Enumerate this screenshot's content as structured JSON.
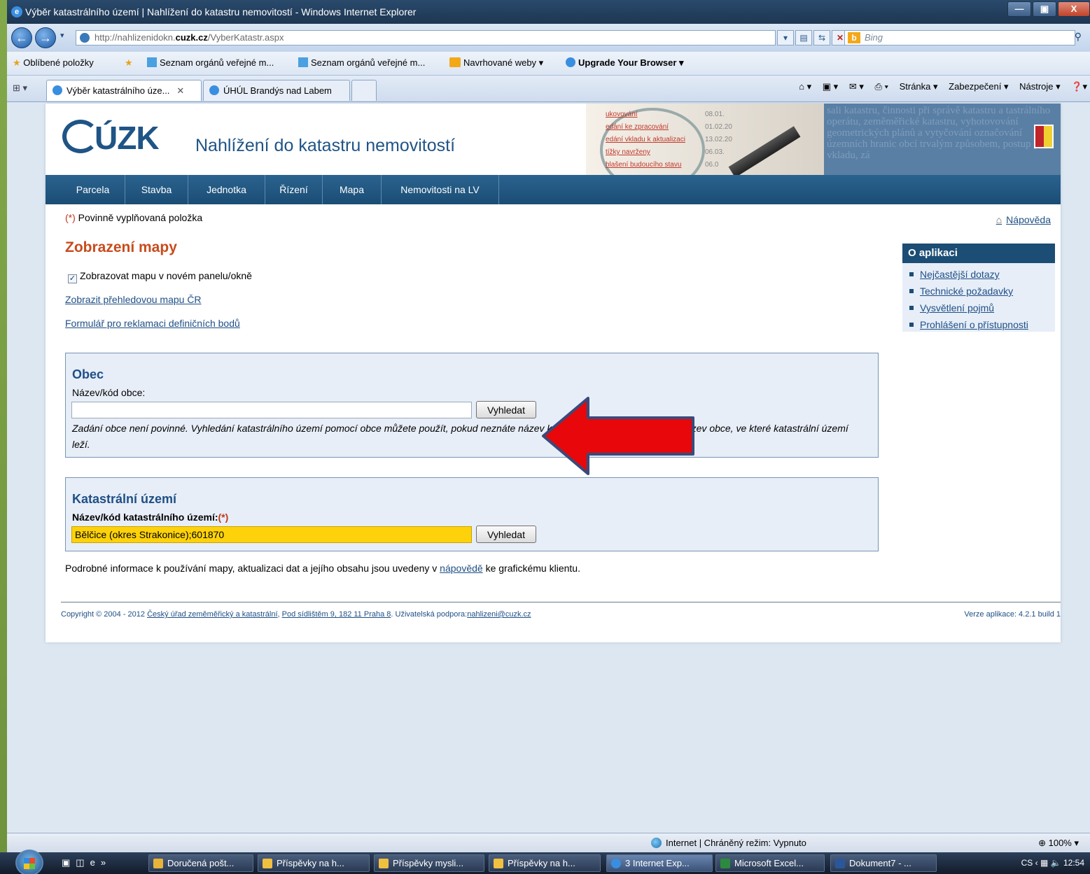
{
  "window": {
    "title": "Výběr katastrálního území | Nahlížení do katastru nemovitostí - Windows Internet Explorer",
    "controls": [
      "—",
      "▣",
      "X"
    ]
  },
  "browser": {
    "url_prefix": "http://nahlizenidokn.",
    "url_domain": "cuzk.cz",
    "url_path": "/VyberKatastr.aspx",
    "search_placeholder": "Bing",
    "favorites_label": "Oblíbené položky",
    "favorites": [
      "Seznam orgánů veřejné m...",
      "Seznam orgánů veřejné m...",
      "Navrhované weby ▾",
      "Upgrade Your Browser ▾"
    ],
    "tabs": [
      {
        "label": "Výběr katastrálního úze...",
        "active": true
      },
      {
        "label": "ÚHÚL Brandýs nad Labem",
        "active": false
      }
    ],
    "commands": [
      "Stránka ▾",
      "Zabezpečení ▾",
      "Nástroje ▾"
    ]
  },
  "page": {
    "logo_text": "ÚZK",
    "app_title": "Nahlížení do katastru nemovitostí",
    "header_image_lines": [
      {
        "text": "ukovování",
        "date": "08.01."
      },
      {
        "text": "edání ke zpracování",
        "date": "01.02.20"
      },
      {
        "text": "edání vkladu k aktualizaci",
        "date": "13.02.20"
      },
      {
        "text": "tížky navrženy",
        "date": "06.03."
      },
      {
        "text": "hlašení budoucího stavu",
        "date": "06.0"
      }
    ],
    "header_side_text": "sali katastru, činnosti při správě katastru a tastrálního operátu, zeměměřické katastru, vyhotovování geometrických plánů a vytyčování označování územních hranic obcí trvalým způsobem, postup při vkladu, zá",
    "menu": [
      "Parcela",
      "Stavba",
      "Jednotka",
      "Řízení",
      "Mapa",
      "Nemovitosti na LV"
    ],
    "required_marker": "(*)",
    "required_note": " Povinně vyplňovaná položka",
    "help_link": "Nápověda",
    "heading": "Zobrazení mapy",
    "checkbox_label": "Zobrazovat mapu v novém panelu/okně",
    "checkbox_checked": true,
    "link_overview_map": "Zobrazit přehledovou mapu ČR",
    "link_complaint_form": "Formulář pro reklamaci definičních bodů",
    "obec": {
      "title": "Obec",
      "label": "Název/kód obce:",
      "value": "",
      "button": "Vyhledat",
      "note": "Zadání obce není povinné. Vyhledání katastrálního území pomocí obce můžete použít, pokud neznáte název katastrálního území, ale znáte název obce, ve které katastrální území leží."
    },
    "katastr": {
      "title": "Katastrální území",
      "label": "Název/kód katastrálního území:",
      "required": "(*)",
      "value": "Bělčice (okres Strakonice);601870",
      "button": "Vyhledat"
    },
    "info_before": "Podrobné informace k používání mapy, aktualizaci dat a jejího obsahu jsou uvedeny v ",
    "info_link": "nápovědě",
    "info_after": " ke grafickému klientu.",
    "footer": {
      "copyright": "Copyright © 2004 - 2012 ",
      "org_link": "Český úřad zeměměřický a katastrální",
      "sep": ", ",
      "address_link": "Pod sídlištěm 9, 182 11 Praha 8",
      "support_text": ". Uživatelská podpora:",
      "email_link": "nahlizeni@cuzk.cz",
      "version": "Verze aplikace: 4.2.1 build 1"
    },
    "sidebar": {
      "title": "O aplikaci",
      "items": [
        "Nejčastější dotazy",
        "Technické požadavky",
        "Vysvětlení pojmů",
        "Prohlášení o přístupnosti"
      ]
    }
  },
  "statusbar": {
    "zone": "Internet | Chráněný režim: Vypnuto",
    "zoom": "100%"
  },
  "taskbar": {
    "items": [
      "Doručená pošt...",
      "Příspěvky na h...",
      "Příspěvky mysli...",
      "Příspěvky na h...",
      "3 Internet Exp...",
      "Microsoft Excel...",
      "Dokument7 - ..."
    ],
    "language": "CS",
    "clock": "12:54"
  },
  "colors": {
    "heading_orange": "#c84b1c",
    "menu_blue": "#1b4d75",
    "highlight_yellow": "#fdd20a",
    "arrow_red": "#e8070a"
  }
}
